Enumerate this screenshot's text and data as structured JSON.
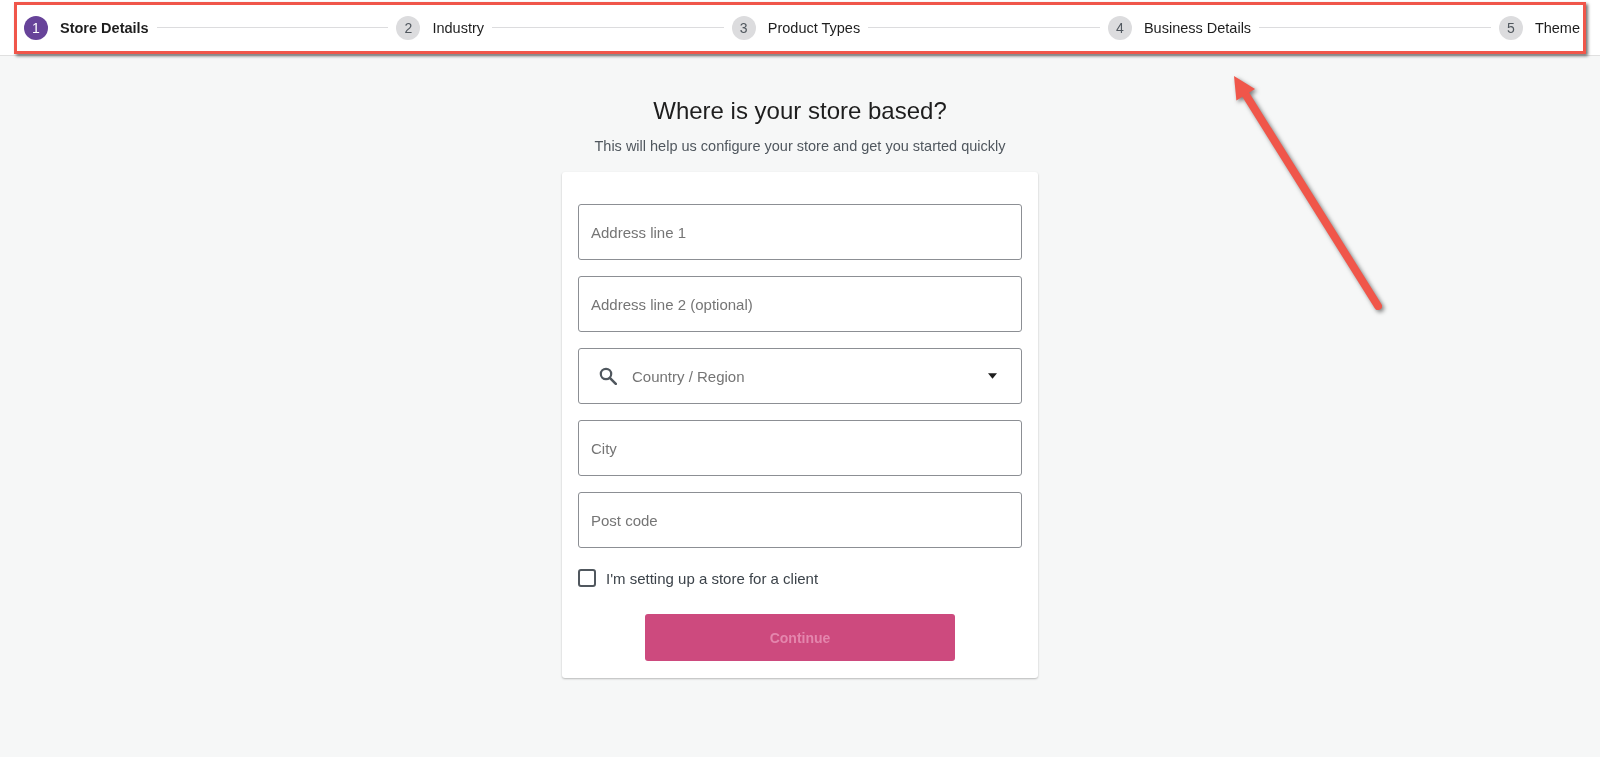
{
  "stepper": {
    "highlighted": true,
    "steps": [
      {
        "number": "1",
        "label": "Store Details",
        "selected": true
      },
      {
        "number": "2",
        "label": "Industry",
        "selected": false
      },
      {
        "number": "3",
        "label": "Product Types",
        "selected": false
      },
      {
        "number": "4",
        "label": "Business Details",
        "selected": false
      },
      {
        "number": "5",
        "label": "Theme",
        "selected": false
      }
    ]
  },
  "heading": {
    "title": "Where is your store based?",
    "subtitle": "This will help us configure your store and get you started quickly"
  },
  "form": {
    "fields": [
      {
        "kind": "text",
        "placeholder": "Address line 1"
      },
      {
        "kind": "text",
        "placeholder": "Address line 2 (optional)"
      },
      {
        "kind": "select",
        "placeholder": "Country / Region"
      },
      {
        "kind": "text",
        "placeholder": "City"
      },
      {
        "kind": "text",
        "placeholder": "Post code"
      }
    ],
    "checkbox": {
      "label": "I'm setting up a store for a client",
      "checked": false
    },
    "button": {
      "label": "Continue",
      "disabled": true
    }
  }
}
